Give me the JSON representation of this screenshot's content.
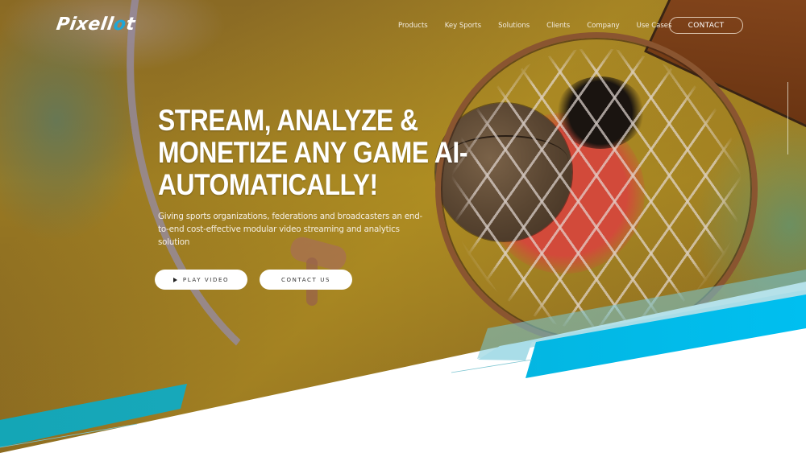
{
  "brand": {
    "logo_main": "Pixell",
    "logo_accent": "o",
    "logo_end": "t",
    "accent_color": "#1ea7d8"
  },
  "nav": {
    "items": [
      {
        "label": "Products"
      },
      {
        "label": "Key Sports"
      },
      {
        "label": "Solutions"
      },
      {
        "label": "Clients"
      },
      {
        "label": "Company"
      },
      {
        "label": "Use Cases"
      }
    ],
    "contact_label": "CONTACT"
  },
  "hero": {
    "headline_lines": [
      "STREAM, ANALYZE &",
      "MONETIZE ANY GAME AI-",
      "AUTOMATICALLY!"
    ],
    "subtext": "Giving sports organizations, federations and broadcasters an end-to-end cost-effective modular video streaming and analytics solution",
    "play_video_label": "PLAY VIDEO",
    "play_icon": "play-icon",
    "contact_us_label": "CONTACT US"
  },
  "colors": {
    "stripe_cyan": "#00bff0",
    "stripe_teal": "#12a4b8",
    "background_court": "#9a7a22"
  }
}
